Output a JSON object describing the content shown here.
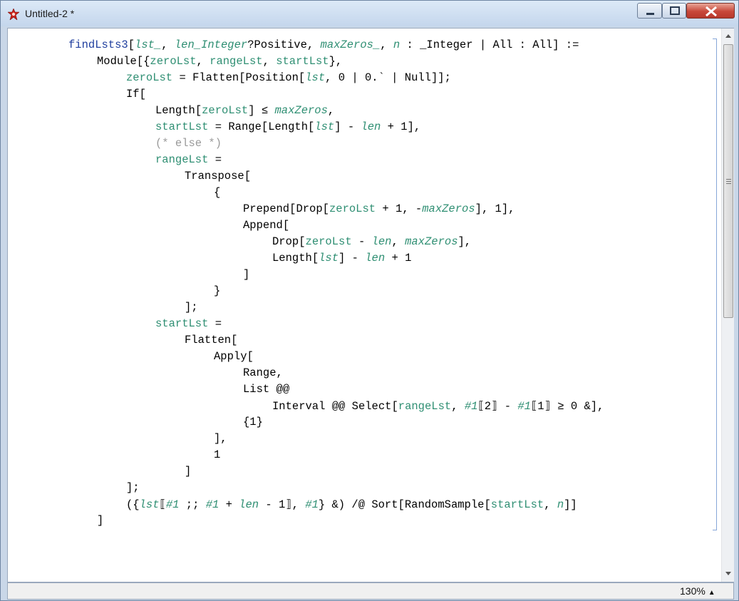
{
  "window": {
    "title": "Untitled-2 *"
  },
  "status": {
    "zoom": "130%"
  },
  "code": {
    "l1": {
      "fn": "findLsts3",
      "a1": "lst_",
      "a2": "len_Integer",
      "a3": "Positive",
      "a4": "maxZeros_",
      "a5": "n",
      "a6": ":",
      "a7": "_Integer",
      "a8": "All",
      "a9": ":",
      "a10": "All",
      "a11": ":="
    },
    "l2": {
      "kw": "Module",
      "v1": "zeroLst",
      "v2": "rangeLst",
      "v3": "startLst"
    },
    "l3": {
      "v1": "zeroLst",
      "eq": "=",
      "fn1": "Flatten",
      "fn2": "Position",
      "a1": "lst",
      "a2": "0",
      "a3": "0.`",
      "a4": "Null"
    },
    "l4": {
      "kw": "If"
    },
    "l5": {
      "fn": "Length",
      "v1": "zeroLst",
      "op": "≤",
      "v2": "maxZeros"
    },
    "l6": {
      "v1": "startLst",
      "eq": "=",
      "fn": "Range",
      "fn2": "Length",
      "v2": "lst",
      "v3": "len",
      "n": "1"
    },
    "l7": {
      "comment": "(* else *)"
    },
    "l8": {
      "v1": "rangeLst",
      "eq": "="
    },
    "l9": {
      "fn": "Transpose"
    },
    "l10": {
      "brace": "{"
    },
    "l11": {
      "fn": "Prepend",
      "fn2": "Drop",
      "v1": "zeroLst",
      "n1": "1",
      "v2": "maxZeros",
      "n2": "1"
    },
    "l12": {
      "fn": "Append"
    },
    "l13": {
      "fn": "Drop",
      "v1": "zeroLst",
      "v2": "len",
      "v3": "maxZeros"
    },
    "l14": {
      "fn": "Length",
      "v1": "lst",
      "v2": "len",
      "n": "1"
    },
    "l15": {
      "b": "]"
    },
    "l16": {
      "b": "}"
    },
    "l17": {
      "b": "];"
    },
    "l18": {
      "v1": "startLst",
      "eq": "="
    },
    "l19": {
      "fn": "Flatten"
    },
    "l20": {
      "fn": "Apply"
    },
    "l21": {
      "fn": "Range"
    },
    "l22": {
      "fn": "List",
      "op": "@@"
    },
    "l23": {
      "fn": "Interval",
      "op": "@@",
      "fn2": "Select",
      "v1": "rangeLst",
      "s1": "#1",
      "i1": "2",
      "s2": "#1",
      "i2": "1",
      "rest": "≥ 0 &"
    },
    "l24": {
      "b": "{1}"
    },
    "l25": {
      "b": "],"
    },
    "l26": {
      "n": "1"
    },
    "l27": {
      "b": "]"
    },
    "l28": {
      "b": "];"
    },
    "l29": {
      "v1": "lst",
      "s1": "#1",
      "s2": "#1",
      "v2": "len",
      "n": "1",
      "s3": "#1",
      "op": "/@",
      "fn": "Sort",
      "fn2": "RandomSample",
      "v3": "startLst",
      "v4": "n"
    },
    "l30": {
      "b": "]"
    }
  },
  "icons": {
    "app": "mathematica-star-icon",
    "min": "minimize-icon",
    "max": "maximize-icon",
    "close": "close-icon"
  }
}
